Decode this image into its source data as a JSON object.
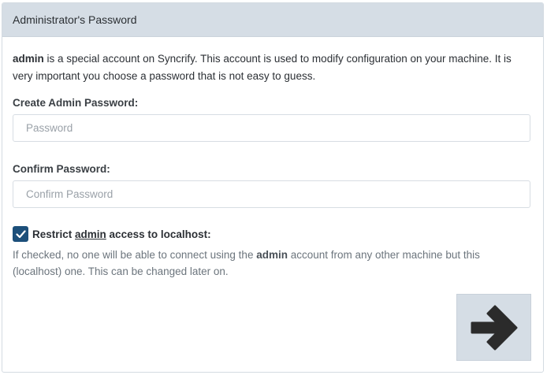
{
  "header": {
    "title": "Administrator's Password"
  },
  "intro": {
    "bold": "admin",
    "text": " is a special account on Syncrify. This account is used to modify configuration on your machine. It is very important you choose a password that is not easy to guess."
  },
  "password": {
    "label": "Create Admin Password:",
    "placeholder": "Password",
    "value": ""
  },
  "confirm": {
    "label": "Confirm Password:",
    "placeholder": "Confirm Password",
    "value": ""
  },
  "restrict": {
    "checked": true,
    "label_prefix": "Restrict ",
    "label_underlined": "admin",
    "label_suffix": " access to localhost:",
    "help_prefix": "If checked, no one will be able to connect using the ",
    "help_bold": "admin",
    "help_suffix": " account from any other machine but this (localhost) one. This can be changed later on."
  },
  "icons": {
    "next": "arrow-right-icon",
    "check": "check-icon"
  },
  "colors": {
    "header_bg": "#d5dde5",
    "checkbox": "#1c4f7a",
    "arrow": "#2b2b2b"
  }
}
